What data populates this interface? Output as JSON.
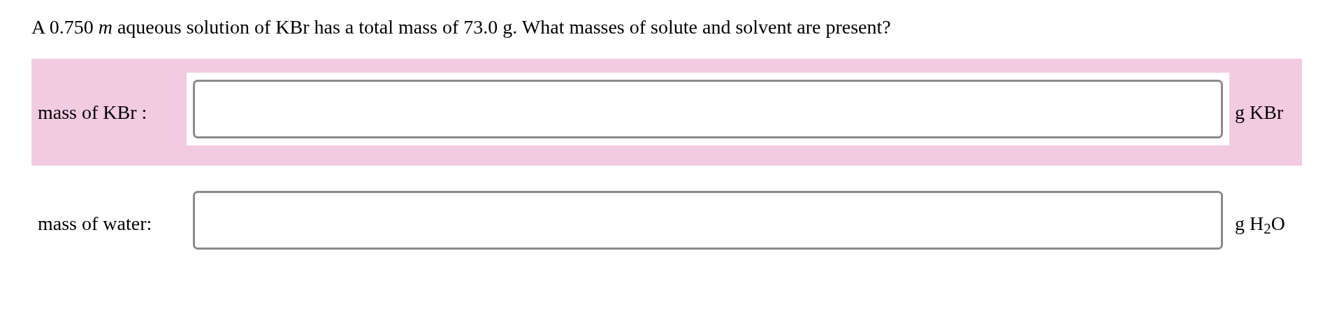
{
  "question": "A 0.750 *m* aqueous solution of KBr has a total mass of 73.0 g. What masses of solute and solvent are present?",
  "answers": [
    {
      "label": "mass of KBr :",
      "unit": "g KBr",
      "highlighted": true
    },
    {
      "label": "mass of water:",
      "unit": "g H$_{2}$O",
      "highlighted": false
    }
  ]
}
